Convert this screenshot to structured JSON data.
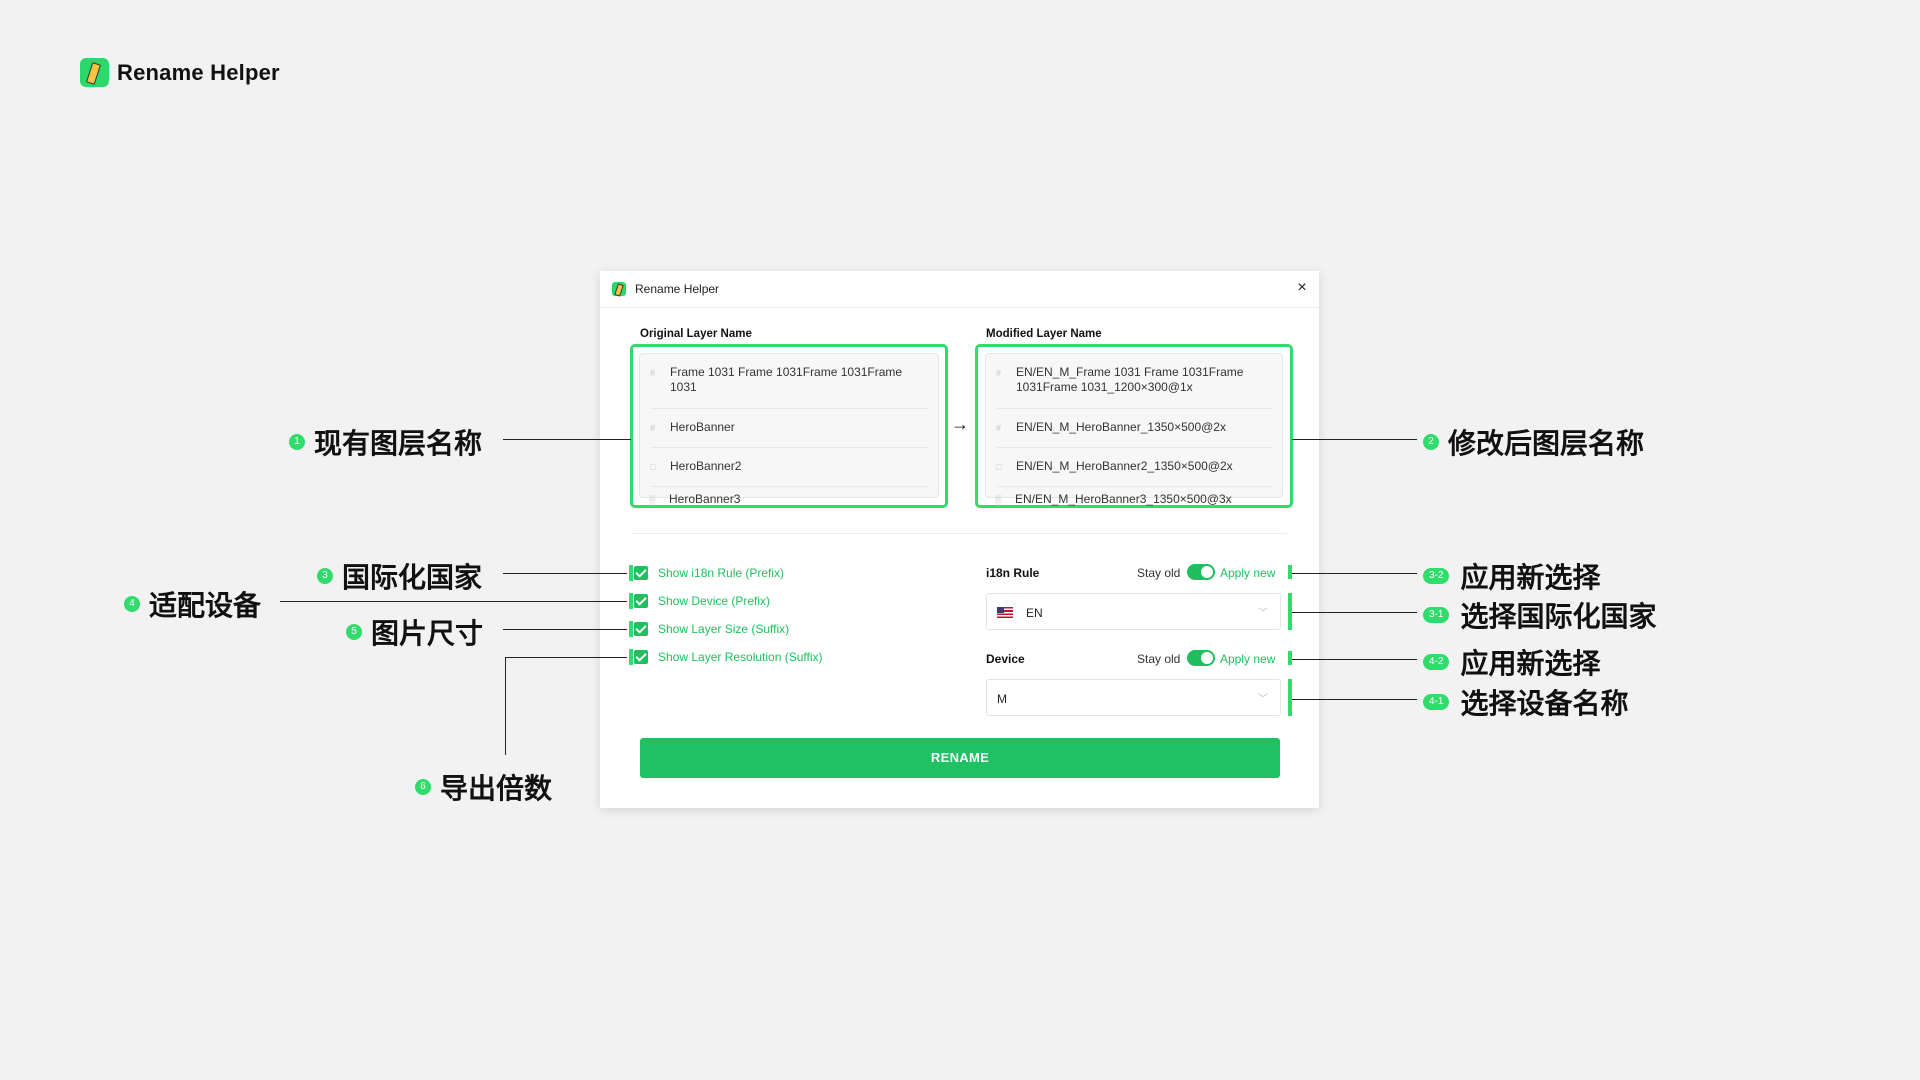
{
  "brand": {
    "title": "Rename Helper"
  },
  "window": {
    "title": "Rename Helper",
    "close_icon": "×",
    "original": {
      "label": "Original Layer Name",
      "rows": [
        "Frame 1031 Frame 1031Frame 1031Frame 1031",
        "HeroBanner",
        "HeroBanner2",
        "HeroBanner3"
      ]
    },
    "modified": {
      "label": "Modified Layer Name",
      "rows": [
        "EN/EN_M_Frame 1031 Frame 1031Frame 1031Frame 1031_1200×300@1x",
        "EN/EN_M_HeroBanner_1350×500@2x",
        "EN/EN_M_HeroBanner2_1350×500@2x",
        "EN/EN_M_HeroBanner3_1350×500@3x"
      ]
    },
    "arrow": "→",
    "options": [
      "Show i18n Rule (Prefix)",
      "Show Device (Prefix)",
      "Show Layer Size (Suffix)",
      "Show Layer Resolution (Suffix)"
    ],
    "i18n": {
      "label": "i18n Rule",
      "stay_old": "Stay old",
      "apply_new": "Apply new",
      "value": "EN",
      "flag": "US"
    },
    "device": {
      "label": "Device",
      "stay_old": "Stay old",
      "apply_new": "Apply new",
      "value": "M"
    },
    "rename_label": "RENAME"
  },
  "annotations": {
    "a1": {
      "badge": "1",
      "text": "现有图层名称"
    },
    "a2": {
      "badge": "2",
      "text": "修改后图层名称"
    },
    "a3": {
      "badge": "3",
      "text": "国际化国家"
    },
    "a4": {
      "badge": "4",
      "text": "适配设备"
    },
    "a5": {
      "badge": "5",
      "text": "图片尺寸"
    },
    "a6": {
      "badge": "6",
      "text": "导出倍数"
    },
    "a32": {
      "badge": "3-2",
      "text": "应用新选择"
    },
    "a31": {
      "badge": "3-1",
      "text": "选择国际化国家"
    },
    "a42": {
      "badge": "4-2",
      "text": "应用新选择"
    },
    "a41": {
      "badge": "4-1",
      "text": "选择设备名称"
    }
  },
  "colors": {
    "accent": "#2fdc6c",
    "button": "#1fc162",
    "check": "#1fbf5f"
  },
  "icons": {
    "brand": "pencil-logo-icon",
    "arrow": "arrow-right-icon",
    "close": "close-icon",
    "dropdown": "chevron-down-icon"
  }
}
